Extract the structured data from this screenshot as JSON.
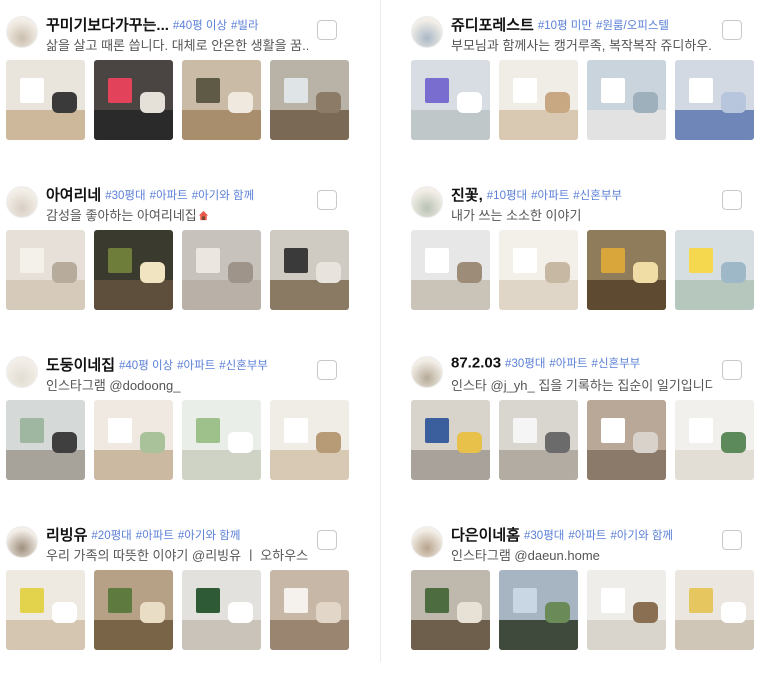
{
  "cards": [
    {
      "name": "꾸미기보다가꾸는...",
      "tags": [
        "#40평 이상",
        "#빌라"
      ],
      "desc": "삶을 살고 때론 씁니다. 대체로 안온한 생활을 꿈...",
      "avatar_color": "#cbbfae",
      "photos": [
        {
          "base": "#e9e4dc",
          "floor": "#cdb89c",
          "a": "#ffffff",
          "b": "#3a3a3a"
        },
        {
          "base": "#4a4542",
          "floor": "#2a2a2a",
          "a": "#e2435b",
          "b": "#e5e0d8"
        },
        {
          "base": "#c9bba6",
          "floor": "#a88e6c",
          "a": "#5e5a45",
          "b": "#efe9df"
        },
        {
          "base": "#b9b2a7",
          "floor": "#7a6a55",
          "a": "#dfe4e6",
          "b": "#8c7b66"
        }
      ]
    },
    {
      "name": "쥬디포레스트",
      "tags": [
        "#10평 미만",
        "#원룸/오피스텔"
      ],
      "desc": "부모님과 함께사는 캥거루족, 복작복작 쥬디하우...",
      "avatar_color": "#a9b8c6",
      "photos": [
        {
          "base": "#d8dde3",
          "floor": "#bfc7c9",
          "a": "#7a6dd0",
          "b": "#ffffff"
        },
        {
          "base": "#f0ece6",
          "floor": "#d9c9b2",
          "a": "#ffffff",
          "b": "#c7a882"
        },
        {
          "base": "#c9d4dc",
          "floor": "#e2e2e2",
          "a": "#ffffff",
          "b": "#9fb0bd"
        },
        {
          "base": "#d3d9e2",
          "floor": "#6f86b8",
          "a": "#ffffff",
          "b": "#b8c6dd"
        }
      ]
    },
    {
      "name": "아여리네",
      "tags": [
        "#30평대",
        "#아파트",
        "#아기와 함께"
      ],
      "desc": "감성을 좋아하는 아여리네집",
      "avatar_color": "#d8cfc4",
      "photos": [
        {
          "base": "#e6e0d8",
          "floor": "#d6cabb",
          "a": "#f4f0ea",
          "b": "#b7ab9b"
        },
        {
          "base": "#3b3a2e",
          "floor": "#5e4f3c",
          "a": "#6f7d3b",
          "b": "#f1e4c0"
        },
        {
          "base": "#c8c2bd",
          "floor": "#b9b1a8",
          "a": "#ebe6e0",
          "b": "#9e948a"
        },
        {
          "base": "#cfcac2",
          "floor": "#8a7a64",
          "a": "#3a3a3a",
          "b": "#e8e3dc"
        }
      ]
    },
    {
      "name": "진꽃,",
      "tags": [
        "#10평대",
        "#아파트",
        "#신혼부부"
      ],
      "desc": "내가 쓰는 소소한 이야기",
      "avatar_color": "#b9c2b4",
      "photos": [
        {
          "base": "#e7e7e7",
          "floor": "#c9c3b8",
          "a": "#ffffff",
          "b": "#9d8c78"
        },
        {
          "base": "#f3efe9",
          "floor": "#e0d6c8",
          "a": "#ffffff",
          "b": "#c6b8a3"
        },
        {
          "base": "#8e7c5a",
          "floor": "#5d4a31",
          "a": "#d8a63a",
          "b": "#f0dca5"
        },
        {
          "base": "#d7dee2",
          "floor": "#b6c7bd",
          "a": "#f6d84f",
          "b": "#9fb8c8"
        }
      ]
    },
    {
      "name": "도둥이네집",
      "tags": [
        "#40평 이상",
        "#아파트",
        "#신혼부부"
      ],
      "desc": "인스타그램 @dodoong_",
      "avatar_color": "#e3ddd3",
      "photos": [
        {
          "base": "#d5d9d8",
          "floor": "#a8a39a",
          "a": "#9fb6a0",
          "b": "#3f3f3f"
        },
        {
          "base": "#efe9e1",
          "floor": "#cbb9a2",
          "a": "#ffffff",
          "b": "#a9c29a"
        },
        {
          "base": "#e9efe8",
          "floor": "#cfd3c6",
          "a": "#9ec08a",
          "b": "#ffffff"
        },
        {
          "base": "#f0ece6",
          "floor": "#d8c9b5",
          "a": "#ffffff",
          "b": "#b79b77"
        }
      ]
    },
    {
      "name": "87.2.03",
      "tags": [
        "#30평대",
        "#아파트",
        "#신혼부부"
      ],
      "desc": "인스타 @j_yh_ 집을 기록하는 집순이 일기입니다...",
      "avatar_color": "#b6aa98",
      "photos": [
        {
          "base": "#d8d4cc",
          "floor": "#a9a29a",
          "a": "#3b5f9c",
          "b": "#e8c14a"
        },
        {
          "base": "#d9d5cf",
          "floor": "#b3aca3",
          "a": "#f5f5f5",
          "b": "#6b6b6b"
        },
        {
          "base": "#b9a898",
          "floor": "#8b7a6a",
          "a": "#ffffff",
          "b": "#d8d2ca"
        },
        {
          "base": "#f2f0ec",
          "floor": "#e2ddd5",
          "a": "#ffffff",
          "b": "#5c8a5a"
        }
      ]
    },
    {
      "name": "리빙유",
      "tags": [
        "#20평대",
        "#아파트",
        "#아기와 함께"
      ],
      "desc": "우리 가족의 따뜻한 이야기 @리빙유 ㅣ 오하우스...",
      "avatar_color": "#a08f7e",
      "photos": [
        {
          "base": "#eeeae2",
          "floor": "#d4c6b0",
          "a": "#e3d34c",
          "b": "#ffffff"
        },
        {
          "base": "#b6a186",
          "floor": "#7a6448",
          "a": "#5f7a3f",
          "b": "#e9ddc6"
        },
        {
          "base": "#e3e1dd",
          "floor": "#c9c3ba",
          "a": "#2e5a35",
          "b": "#ffffff"
        },
        {
          "base": "#c7b7a6",
          "floor": "#9a8571",
          "a": "#f5f1ec",
          "b": "#e2d6c8"
        }
      ]
    },
    {
      "name": "다은이네홈",
      "tags": [
        "#30평대",
        "#아파트",
        "#아기와 함께"
      ],
      "desc": "인스타그램 @daeun.home",
      "avatar_color": "#b8a38c",
      "photos": [
        {
          "base": "#bfb9ad",
          "floor": "#6e5f4d",
          "a": "#4d6d41",
          "b": "#e8e2d6"
        },
        {
          "base": "#a7b5c2",
          "floor": "#3f4a3d",
          "a": "#c9d7e4",
          "b": "#6a8a58"
        },
        {
          "base": "#efedea",
          "floor": "#d9d4cc",
          "a": "#ffffff",
          "b": "#8b6f52"
        },
        {
          "base": "#ebe7e0",
          "floor": "#cfc6b8",
          "a": "#e6c65f",
          "b": "#ffffff"
        }
      ]
    }
  ]
}
